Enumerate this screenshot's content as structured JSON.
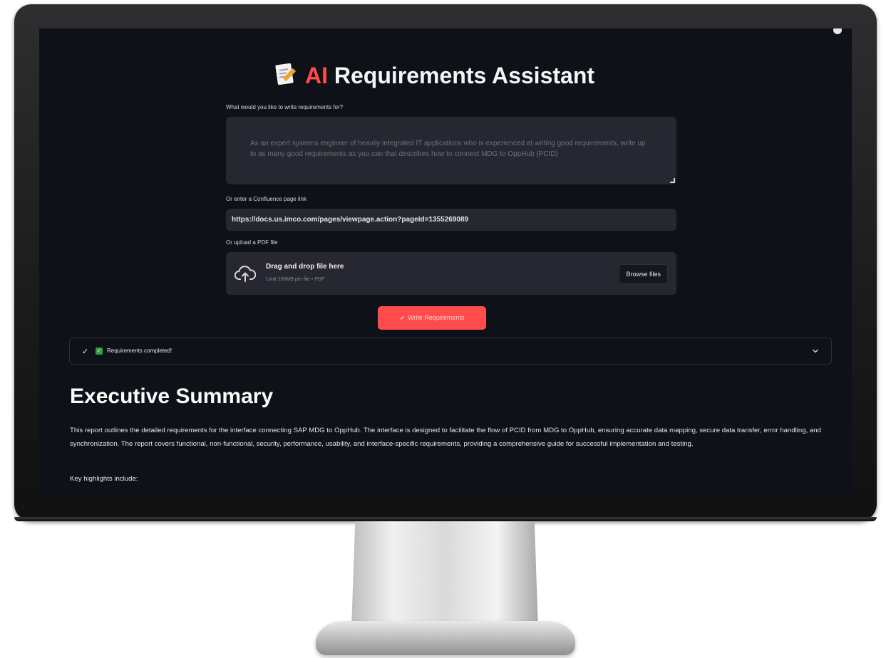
{
  "app": {
    "title_prefix": "AI",
    "title_rest": "Requirements Assistant"
  },
  "prompt": {
    "label": "What would you like to write requirements for?",
    "placeholder": "As an expert systems engineer of heavily integrated IT applications who is experienced at writing good requirements, write up to as many good requirements as you can that describes how to connect MDG to OppHub (PCID)"
  },
  "confluence": {
    "label": "Or enter a Confluence page link",
    "value": "https://docs.us.imco.com/pages/viewpage.action?pageId=1355269089"
  },
  "upload": {
    "label": "Or upload a PDF file",
    "drop_text": "Drag and drop file here",
    "limit_text": "Limit 200MB per file • PDF",
    "browse_label": "Browse files"
  },
  "actions": {
    "write_label": "Write Requirements"
  },
  "status": {
    "text": "Requirements completed!"
  },
  "report": {
    "heading": "Executive Summary",
    "paragraph": "This report outlines the detailed requirements for the interface connecting SAP MDG to OppHub. The interface is designed to facilitate the flow of PCID from MDG to OppHub, ensuring accurate data mapping, secure data transfer, error handling, and synchronization. The report covers functional, non-functional, security, performance, usability, and interface-specific requirements, providing a comprehensive guide for successful implementation and testing.",
    "highlights_intro": "Key highlights include:"
  },
  "colors": {
    "accent": "#ff4b4b",
    "background": "#0e1117",
    "input_bg": "#262730",
    "success": "#2ea043"
  },
  "icons": [
    "memo-icon",
    "cloud-upload-icon",
    "rocket-icon",
    "check-icon",
    "green-check-icon",
    "chevron-down-icon",
    "menu-icon"
  ]
}
